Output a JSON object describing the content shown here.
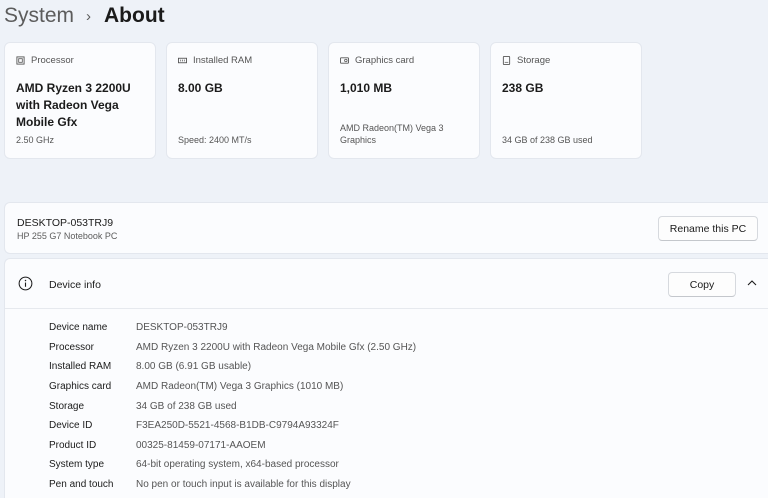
{
  "breadcrumb": {
    "parent": "System",
    "separator": "›",
    "current": "About"
  },
  "cards": [
    {
      "icon": "processor-icon",
      "label": "Processor",
      "value": "AMD Ryzen 3 2200U with Radeon Vega Mobile Gfx",
      "sub": "2.50 GHz"
    },
    {
      "icon": "ram-icon",
      "label": "Installed RAM",
      "value": "8.00 GB",
      "sub": "Speed: 2400 MT/s"
    },
    {
      "icon": "graphics-card-icon",
      "label": "Graphics card",
      "value": "1,010 MB",
      "sub": "AMD Radeon(TM) Vega 3 Graphics"
    },
    {
      "icon": "storage-icon",
      "label": "Storage",
      "value": "238 GB",
      "sub": "34 GB of 238 GB used"
    }
  ],
  "pc": {
    "name": "DESKTOP-053TRJ9",
    "model": "HP 255 G7 Notebook PC",
    "rename_label": "Rename this PC"
  },
  "device_info": {
    "title": "Device info",
    "copy_label": "Copy",
    "rows": [
      {
        "key": "Device name",
        "value": "DESKTOP-053TRJ9"
      },
      {
        "key": "Processor",
        "value": "AMD Ryzen 3 2200U with Radeon Vega Mobile Gfx (2.50 GHz)"
      },
      {
        "key": "Installed RAM",
        "value": "8.00 GB (6.91 GB usable)"
      },
      {
        "key": "Graphics card",
        "value": "AMD Radeon(TM) Vega 3 Graphics (1010 MB)"
      },
      {
        "key": "Storage",
        "value": "34 GB of 238 GB used"
      },
      {
        "key": "Device ID",
        "value": "F3EA250D-5521-4568-B1DB-C9794A93324F"
      },
      {
        "key": "Product ID",
        "value": "00325-81459-07171-AAOEM"
      },
      {
        "key": "System type",
        "value": "64-bit operating system, x64-based processor"
      },
      {
        "key": "Pen and touch",
        "value": "No pen or touch input is available for this display"
      }
    ]
  },
  "colors": {
    "background": "#eef2f8",
    "card": "#fbfcfe",
    "border": "#e3e7ee",
    "text": "#1b1b1b",
    "muted": "#555555"
  }
}
